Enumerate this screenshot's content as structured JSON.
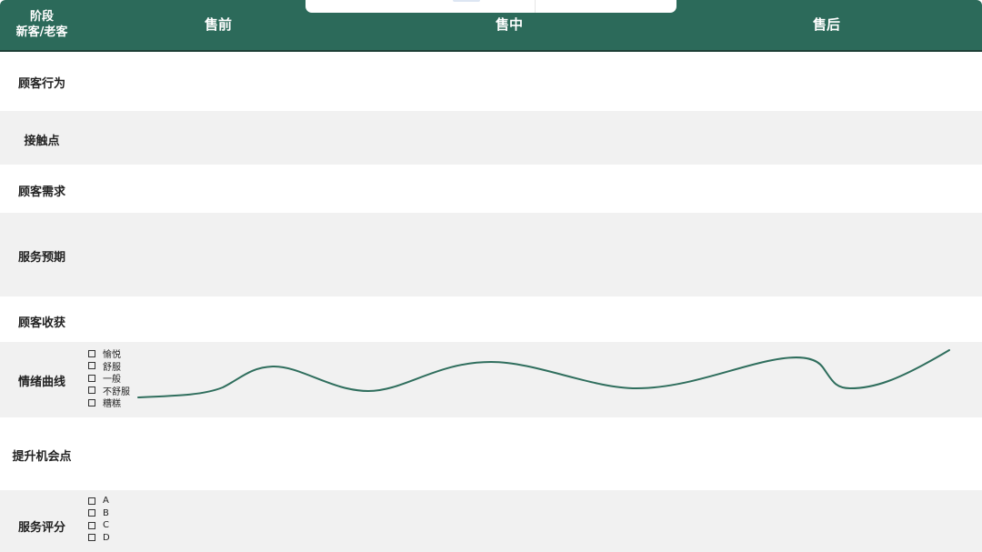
{
  "header": {
    "stage_label": "阶段",
    "customer_type_label": "新客/老客",
    "columns": [
      "售前",
      "售中",
      "售后"
    ]
  },
  "rows": [
    {
      "label": "顾客行为"
    },
    {
      "label": "接触点"
    },
    {
      "label": "顾客需求"
    },
    {
      "label": "服务预期"
    },
    {
      "label": "顾客收获"
    },
    {
      "label": "情绪曲线",
      "options": [
        "愉悦",
        "舒服",
        "一般",
        "不舒服",
        "糟糕"
      ]
    },
    {
      "label": "提升机会点"
    },
    {
      "label": "服务评分",
      "options": [
        "A",
        "B",
        "C",
        "D"
      ]
    }
  ],
  "colors": {
    "header_bg": "#2c6a5a",
    "header_text": "#ffffff",
    "row_alt_bg": "#f1f1f1",
    "curve": "#2f6e5d"
  }
}
